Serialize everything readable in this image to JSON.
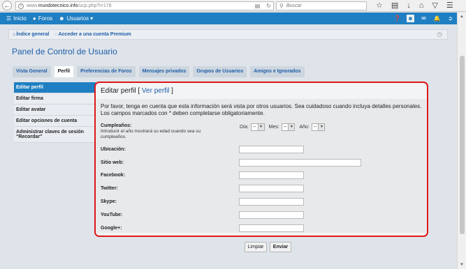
{
  "browser": {
    "url_prefix": "www.",
    "url_domain": "mundotecnico.info",
    "url_path": "/ucp.php?i=178",
    "search_placeholder": "Buscar"
  },
  "navbar": {
    "items": [
      {
        "label": "Inicio",
        "icon": "menu-icon"
      },
      {
        "label": "Foros",
        "icon": "chat-icon"
      },
      {
        "label": "Usuarios",
        "icon": "users-icon"
      }
    ]
  },
  "breadcrumb": {
    "items": [
      {
        "label": "Índice general",
        "icon": "home-icon"
      },
      {
        "label": "Acceder a una cuenta Premium",
        "icon": "premium-icon"
      }
    ]
  },
  "panel": {
    "title": "Panel de Control de Usuario"
  },
  "tabs": [
    {
      "label": "Vista General",
      "active": false
    },
    {
      "label": "Perfil",
      "active": true
    },
    {
      "label": "Preferencias de Foros",
      "active": false
    },
    {
      "label": "Mensajes privados",
      "active": false
    },
    {
      "label": "Grupos de Usuarios",
      "active": false
    },
    {
      "label": "Amigos e Ignorados",
      "active": false
    }
  ],
  "sidebar": {
    "items": [
      {
        "label": "Editar perfil",
        "active": true
      },
      {
        "label": "Editar firma",
        "active": false
      },
      {
        "label": "Editar avatar",
        "active": false
      },
      {
        "label": "Editar opciones de cuenta",
        "active": false
      },
      {
        "label": "Administrar claves de sesión \"Recordar\"",
        "active": false
      }
    ]
  },
  "form": {
    "heading": "Editar perfil",
    "view_link": "Ver perfil",
    "bracket_open": " [ ",
    "bracket_close": " ]",
    "intro": "Por favor, tenga en cuenta que esta información será vista por otros usuarios. Sea cuidadoso cuando incluya detalles personales. Los campos marcados con * deben completarse obligatoriamente.",
    "birthday": {
      "label": "Cumpleaños:",
      "hint": "Introducir el año mostrará su edad cuando sea su cumpleaños.",
      "day_label": "Día:",
      "month_label": "Mes:",
      "year_label": "Año:",
      "day_value": "--",
      "month_value": "--",
      "year_value": "--"
    },
    "fields": [
      {
        "label": "Ubicación:",
        "value": ""
      },
      {
        "label": "Sitio web:",
        "value": ""
      },
      {
        "label": "Facebook:",
        "value": ""
      },
      {
        "label": "Twitter:",
        "value": ""
      },
      {
        "label": "Skype:",
        "value": ""
      },
      {
        "label": "YouTube:",
        "value": ""
      },
      {
        "label": "Google+:",
        "value": ""
      }
    ]
  },
  "buttons": {
    "reset": "Limpiar",
    "submit": "Enviar"
  },
  "colors": {
    "navbar": "#1f7fc2",
    "link": "#1f5ea8",
    "highlight_border": "#e01717"
  }
}
